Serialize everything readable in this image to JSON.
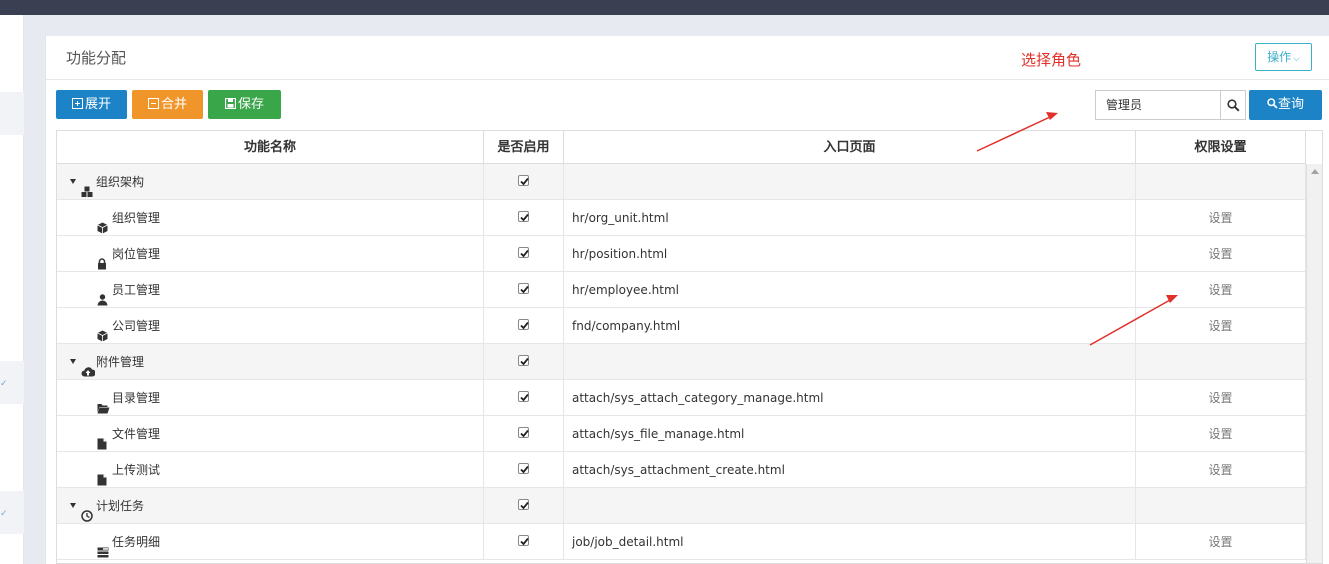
{
  "panel": {
    "title": "功能分配",
    "role_hint": "选择角色",
    "ops_label": "操作"
  },
  "toolbar": {
    "expand_label": "展开",
    "merge_label": "合并",
    "save_label": "保存"
  },
  "role_search": {
    "value": "管理员",
    "query_label": "查询"
  },
  "grid": {
    "columns": [
      "功能名称",
      "是否启用",
      "入口页面",
      "权限设置"
    ],
    "rows": [
      {
        "name": "组织架构",
        "icon": "cubes-icon",
        "group": true,
        "enabled": true,
        "page": "",
        "action": ""
      },
      {
        "name": "组织管理",
        "icon": "cube-icon",
        "group": false,
        "enabled": true,
        "page": "hr/org_unit.html",
        "action": "设置"
      },
      {
        "name": "岗位管理",
        "icon": "lock-icon",
        "group": false,
        "enabled": true,
        "page": "hr/position.html",
        "action": "设置"
      },
      {
        "name": "员工管理",
        "icon": "user-icon",
        "group": false,
        "enabled": true,
        "page": "hr/employee.html",
        "action": "设置"
      },
      {
        "name": "公司管理",
        "icon": "cube-icon",
        "group": false,
        "enabled": true,
        "page": "fnd/company.html",
        "action": "设置"
      },
      {
        "name": "附件管理",
        "icon": "cloud-upload-icon",
        "group": true,
        "enabled": true,
        "page": "",
        "action": ""
      },
      {
        "name": "目录管理",
        "icon": "folder-open-icon",
        "group": false,
        "enabled": true,
        "page": "attach/sys_attach_category_manage.html",
        "action": "设置"
      },
      {
        "name": "文件管理",
        "icon": "file-icon",
        "group": false,
        "enabled": true,
        "page": "attach/sys_file_manage.html",
        "action": "设置"
      },
      {
        "name": "上传测试",
        "icon": "file-icon",
        "group": false,
        "enabled": true,
        "page": "attach/sys_attachment_create.html",
        "action": "设置"
      },
      {
        "name": "计划任务",
        "icon": "clock-icon",
        "group": true,
        "enabled": true,
        "page": "",
        "action": ""
      },
      {
        "name": "任务明细",
        "icon": "tasks-icon",
        "group": false,
        "enabled": true,
        "page": "job/job_detail.html",
        "action": "设置"
      }
    ]
  },
  "colors": {
    "primary": "#1c84c6",
    "warning": "#f0952a",
    "success": "#3aa64a",
    "annotation": "#e0302a",
    "topbar": "#3a3f51"
  }
}
